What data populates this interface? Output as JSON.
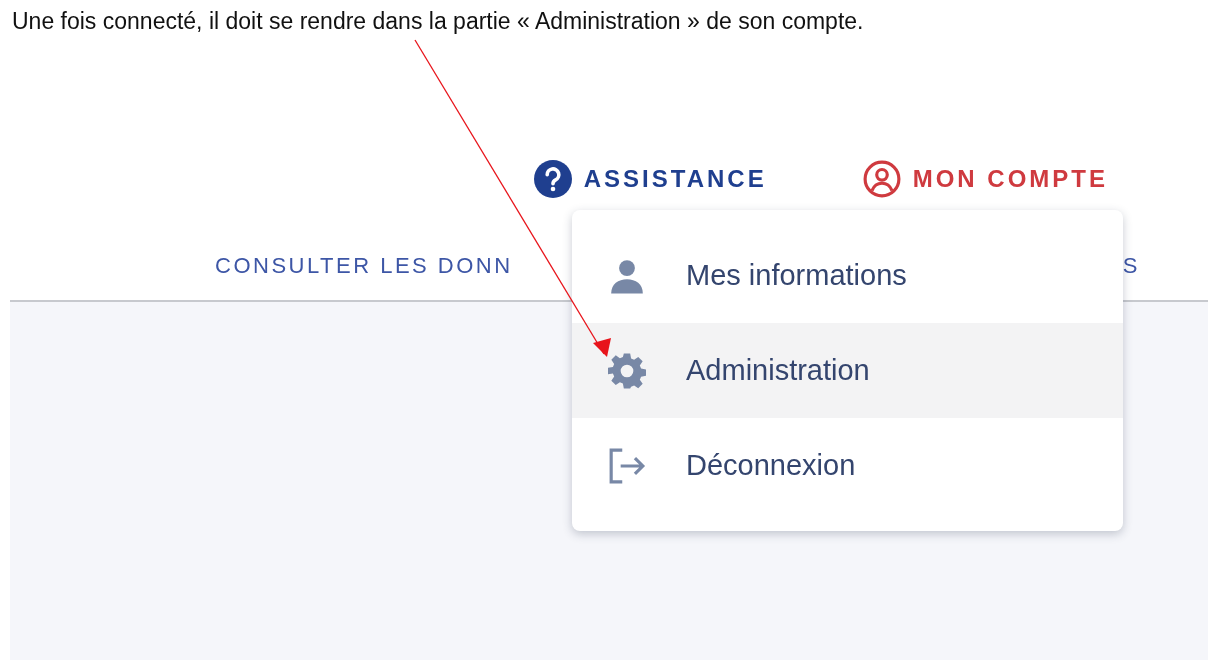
{
  "caption": "Une fois connecté, il doit se rendre dans la partie « Administration » de son compte.",
  "header": {
    "links": [
      {
        "kind": "help",
        "label": "ASSISTANCE"
      },
      {
        "kind": "account",
        "label": "MON COMPTE"
      }
    ]
  },
  "nav": {
    "items": [
      "CONSULTER LES DONN",
      "S"
    ]
  },
  "account_menu": {
    "items": [
      {
        "kind": "person",
        "label": "Mes informations",
        "selected": false
      },
      {
        "kind": "gear",
        "label": "Administration",
        "selected": true
      },
      {
        "kind": "logout",
        "label": "Déconnexion",
        "selected": false
      }
    ]
  }
}
